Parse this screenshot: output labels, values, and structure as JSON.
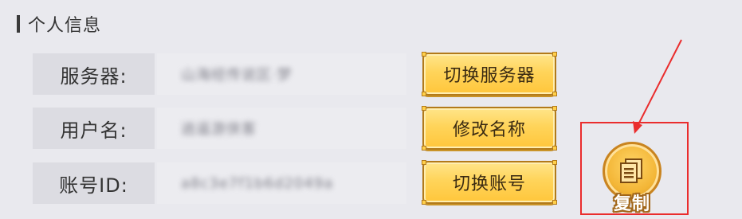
{
  "section": {
    "title": "个人信息"
  },
  "rows": [
    {
      "label": "服务器:",
      "value": "山海经传说区·梦",
      "button": "切换服务器"
    },
    {
      "label": "用户名:",
      "value": "逍遥游侠客",
      "button": "修改名称"
    },
    {
      "label": "账号ID:",
      "value": "a8c3e7f1b6d2049a",
      "button": "切换账号"
    }
  ],
  "copy": {
    "label": "复制"
  },
  "colors": {
    "annotation": "#ea2d2d",
    "gold": "#ffd45a"
  }
}
